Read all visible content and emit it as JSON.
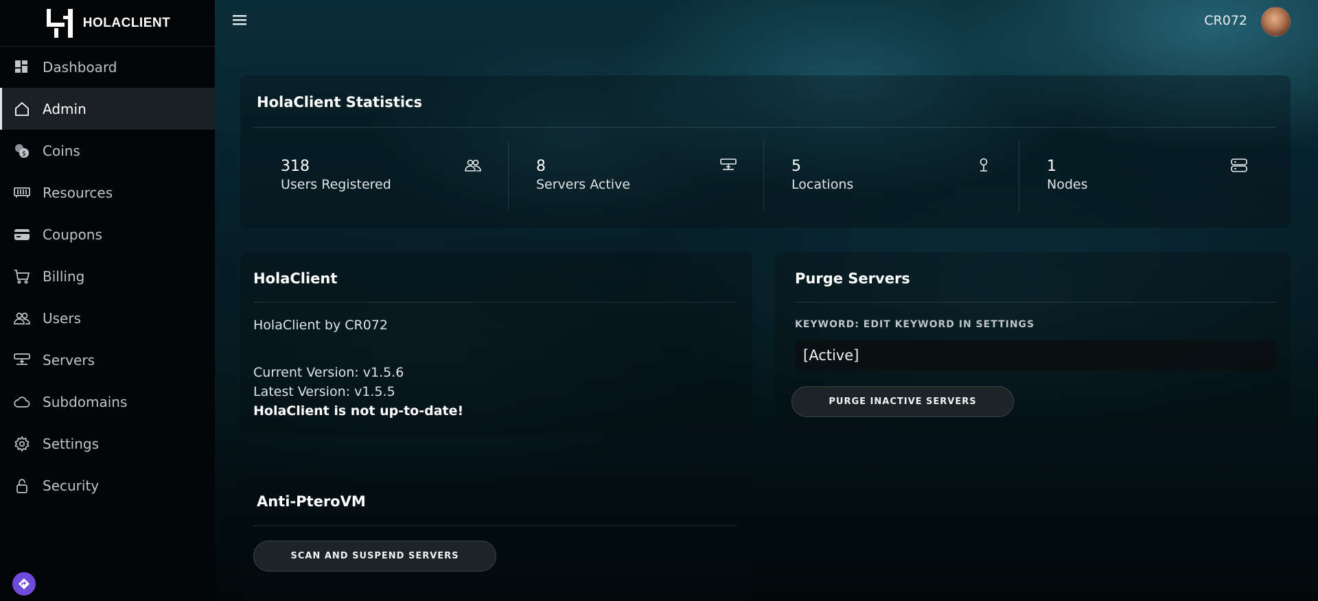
{
  "brand": {
    "name": "HOLACLIENT"
  },
  "sidebar": {
    "items": [
      {
        "label": "Dashboard",
        "icon": "dashboard-icon"
      },
      {
        "label": "Admin",
        "icon": "home-icon",
        "active": true
      },
      {
        "label": "Coins",
        "icon": "coins-icon"
      },
      {
        "label": "Resources",
        "icon": "memory-icon"
      },
      {
        "label": "Coupons",
        "icon": "card-icon"
      },
      {
        "label": "Billing",
        "icon": "cart-icon"
      },
      {
        "label": "Users",
        "icon": "users-icon"
      },
      {
        "label": "Servers",
        "icon": "server-icon"
      },
      {
        "label": "Subdomains",
        "icon": "cloud-icon"
      },
      {
        "label": "Settings",
        "icon": "gear-icon"
      },
      {
        "label": "Security",
        "icon": "lock-icon"
      }
    ]
  },
  "header": {
    "username": "CR072"
  },
  "stats": {
    "title": "HolaClient Statistics",
    "items": [
      {
        "value": "318",
        "label": "Users Registered",
        "icon": "users-icon"
      },
      {
        "value": "8",
        "label": "Servers Active",
        "icon": "server-icon"
      },
      {
        "value": "5",
        "label": "Locations",
        "icon": "location-pin-icon"
      },
      {
        "value": "1",
        "label": "Nodes",
        "icon": "database-icon"
      }
    ]
  },
  "holaclient": {
    "title": "HolaClient",
    "by_line": "HolaClient by CR072",
    "current_version": "Current Version: v1.5.6",
    "latest_version": "Latest Version: v1.5.5",
    "status": "HolaClient is not up-to-date!"
  },
  "purge": {
    "title": "Purge Servers",
    "keyword_label": "KEYWORD: EDIT KEYWORD IN SETTINGS",
    "keyword_value": "[Active]",
    "button_label": "PURGE INACTIVE SERVERS"
  },
  "anti_pterovm": {
    "title": "Anti-PteroVM",
    "button_label": "SCAN AND SUSPEND SERVERS"
  },
  "colors": {
    "sidebar_bg": "#030405",
    "active_item_bg": "#1b2024",
    "help_button": "#6e4bd8"
  }
}
